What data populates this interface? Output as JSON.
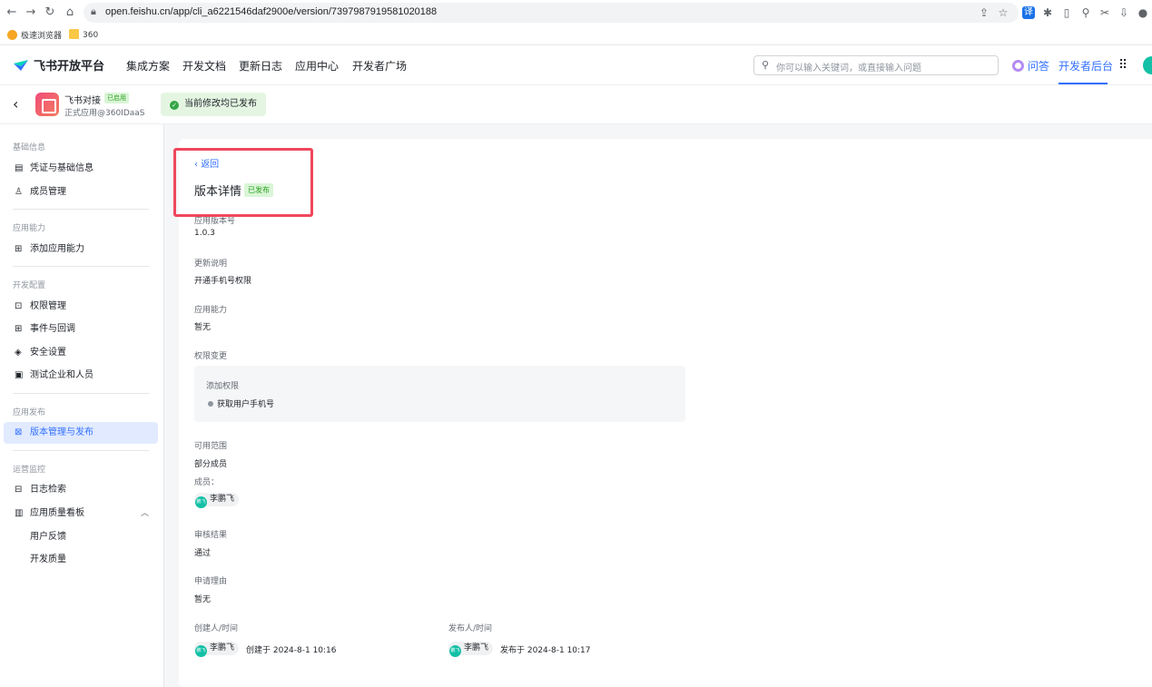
{
  "browser": {
    "url": "open.feishu.cn/app/cli_a6221546daf2900e/version/7397987919581020188",
    "bookmarks": [
      "极速浏览器",
      "360"
    ],
    "translate_icon": "译"
  },
  "header": {
    "logo": "飞书开放平台",
    "nav": [
      "集成方案",
      "开发文档",
      "更新日志",
      "应用中心",
      "开发者广场"
    ],
    "search_placeholder": "你可以输入关键词，或直接输入问题",
    "ask": "问答",
    "dev_backend": "开发者后台"
  },
  "appbar": {
    "app_name": "飞书对接",
    "app_badge": "已启用",
    "app_sub": "正式应用@360IDaaS",
    "status": "当前修改均已发布"
  },
  "sidebar": {
    "sections": [
      {
        "title": "基础信息",
        "items": [
          "凭证与基础信息",
          "成员管理"
        ]
      },
      {
        "title": "应用能力",
        "items": [
          "添加应用能力"
        ]
      },
      {
        "title": "开发配置",
        "items": [
          "权限管理",
          "事件与回调",
          "安全设置",
          "测试企业和人员"
        ]
      },
      {
        "title": "应用发布",
        "items": [
          "版本管理与发布"
        ]
      },
      {
        "title": "运营监控",
        "items": [
          "日志检索",
          "应用质量看板",
          "用户反馈",
          "开发质量"
        ]
      }
    ]
  },
  "main": {
    "back": "返回",
    "title": "版本详情",
    "title_badge": "已发布",
    "fields": {
      "version_label": "应用版本号",
      "version_value": "1.0.3",
      "notes_label": "更新说明",
      "notes_value": "开通手机号权限",
      "ability_label": "应用能力",
      "ability_value": "暂无",
      "perm_label": "权限变更",
      "perm_add_title": "添加权限",
      "perm_add_item": "获取用户手机号",
      "scope_label": "可用范围",
      "scope_value": "部分成员",
      "member_label": "成员：",
      "member_name": "李鹏飞",
      "review_label": "审核结果",
      "review_value": "通过",
      "reason_label": "申请理由",
      "reason_value": "暂无",
      "creator_label": "创建人/时间",
      "creator_name": "李鹏飞",
      "creator_time": "创建于 2024-8-1 10:16",
      "publisher_label": "发布人/时间",
      "publisher_name": "李鹏飞",
      "publisher_time": "发布于 2024-8-1 10:17",
      "avatar_text": "鹏飞"
    }
  }
}
